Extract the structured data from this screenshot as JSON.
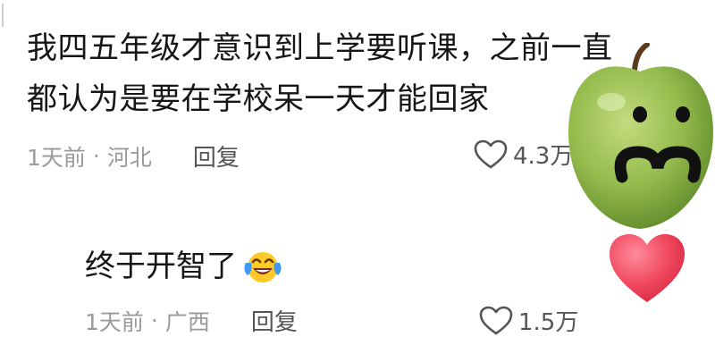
{
  "comment": {
    "line1": "我四五年级才意识到上学要听课，之前一直",
    "line2": "都认为是要在学校呆一天才能回家",
    "time": "1天前",
    "separator": "·",
    "location": "河北",
    "reply_label": "回复",
    "likes": "4.3万"
  },
  "reply": {
    "text": "终于开智了",
    "emoji": "laughing-crying-emoji",
    "time": "1天前",
    "separator": "·",
    "location": "广西",
    "reply_label": "回复",
    "likes": "1.5万"
  },
  "sticker": {
    "face": "apple-face-sticker",
    "heart": "heart-icon"
  },
  "colors": {
    "text": "#161616",
    "meta": "#9a9a9a",
    "apple_green": "#8fb84a",
    "heart_red": "#f0475e"
  }
}
